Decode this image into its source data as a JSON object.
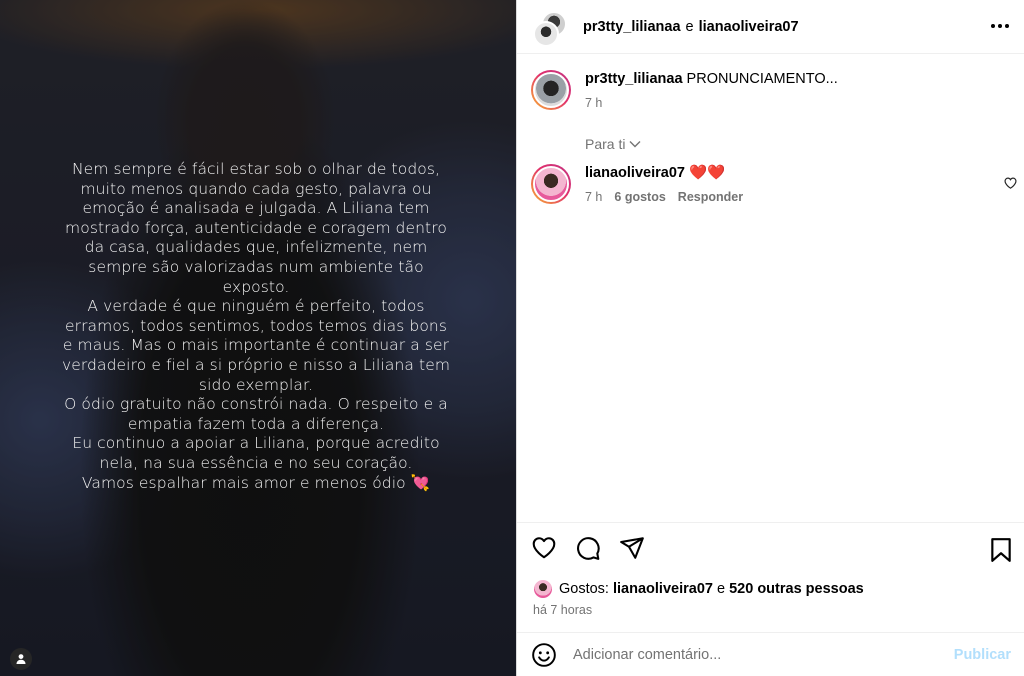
{
  "story": {
    "paragraphs": [
      "Nem sempre é fácil estar sob o olhar de todos, muito menos quando cada gesto, palavra ou emoção é analisada e julgada. A Liliana tem mostrado força, autenticidade e coragem dentro da casa, qualidades que, infelizmente, nem sempre são valorizadas num ambiente tão exposto.",
      "A verdade é que ninguém é perfeito, todos erramos, todos sentimos, todos temos dias bons e maus. Mas o mais importante é continuar a ser verdadeiro e fiel a si próprio e nisso a Liliana tem sido exemplar.",
      "O ódio gratuito não constrói nada. O respeito e a empatia fazem toda a diferença.",
      "Eu continuo a apoiar a Liliana, porque acredito nela, na sua essência e no seu coração.",
      "Vamos espalhar mais amor e menos ódio 💘"
    ],
    "tag_icon": "user-tag-icon"
  },
  "header": {
    "user1": "pr3tty_lilianaa",
    "separator": "e",
    "user2": "lianaoliveira07",
    "more_icon": "more-horizontal-icon"
  },
  "caption": {
    "username": "pr3tty_lilianaa",
    "text": "PRONUNCIAMENTO...",
    "time": "7 h"
  },
  "filter": {
    "label": "Para ti"
  },
  "comment": {
    "username": "lianaoliveira07",
    "text": "❤️❤️",
    "time": "7 h",
    "likes": "6 gostos",
    "reply": "Responder"
  },
  "likes": {
    "prefix": "Gostos:",
    "user": "lianaoliveira07",
    "joiner": "e",
    "others": "520 outras pessoas"
  },
  "time_ago": "há 7 horas",
  "add_comment": {
    "placeholder": "Adicionar comentário...",
    "publish": "Publicar"
  },
  "colors": {
    "accent": "#0095f6",
    "publish_disabled": "#b2dffc",
    "muted": "#737373",
    "story_ring_start": "#f9b430",
    "story_ring_end": "#c13584"
  }
}
